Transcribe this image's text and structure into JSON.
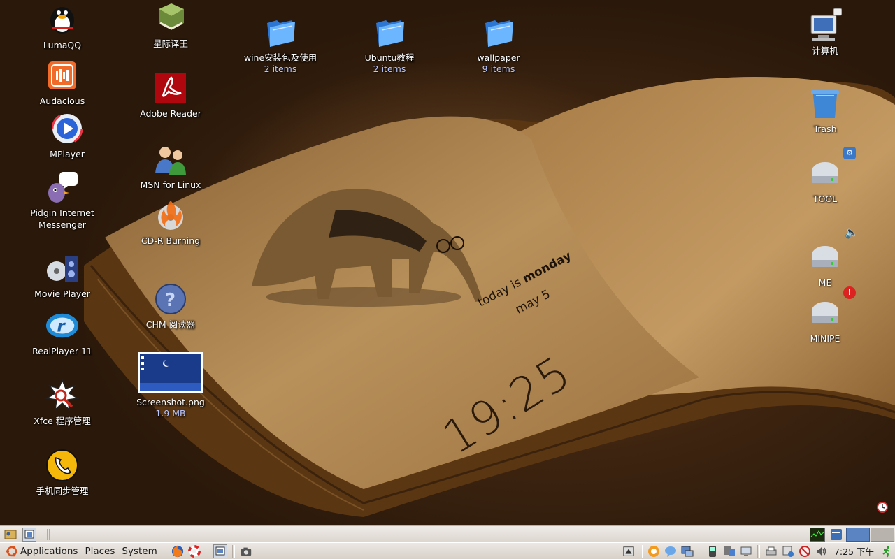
{
  "wallpaper": {
    "today_prefix": "today is ",
    "today_day": "monday",
    "date": "may 5",
    "clock": "19:25"
  },
  "desktop": {
    "col1": [
      {
        "label": "LumaQQ",
        "icon": "penguin-icon"
      },
      {
        "label": "Audacious",
        "icon": "audacious-icon"
      },
      {
        "label": "MPlayer",
        "icon": "play-icon"
      },
      {
        "label": "Pidgin Internet Messenger",
        "icon": "pidgin-icon"
      },
      {
        "label": "Movie Player",
        "icon": "movie-icon"
      },
      {
        "label": "RealPlayer 11",
        "icon": "realplayer-icon"
      },
      {
        "label": "Xfce 程序管理",
        "icon": "xfce-icon"
      },
      {
        "label": "手机同步管理",
        "icon": "phone-icon"
      }
    ],
    "col2": [
      {
        "label": "星际译王",
        "icon": "dictionary-book-icon"
      },
      {
        "label": "Adobe Reader",
        "icon": "pdf-icon"
      },
      {
        "label": "MSN for Linux",
        "icon": "msn-people-icon"
      },
      {
        "label": "CD-R Burning",
        "icon": "burn-icon"
      },
      {
        "label": "CHM 阅读器",
        "icon": "help-icon"
      },
      {
        "label": "Screenshot.png",
        "sub": "1.9 MB",
        "icon": "image-thumbnail-icon"
      }
    ],
    "folders": [
      {
        "label": "wine安装包及使用",
        "sub": "2 items"
      },
      {
        "label": "Ubuntu教程",
        "sub": "2 items"
      },
      {
        "label": "wallpaper",
        "sub": "9 items"
      }
    ],
    "right": [
      {
        "label": "计算机",
        "icon": "computer-icon"
      },
      {
        "label": "Trash",
        "icon": "trash-icon"
      },
      {
        "label": "TOOL",
        "icon": "drive-icon"
      },
      {
        "label": "ME",
        "icon": "drive-icon"
      },
      {
        "label": "MINIPE",
        "icon": "drive-icon"
      }
    ]
  },
  "panel": {
    "menu_applications": "Applications",
    "menu_places": "Places",
    "menu_system": "System",
    "clock": "7:25 下午"
  },
  "colors": {
    "panel_bg": "#e6e1db",
    "folder_blue": "#3d8fe6",
    "workspace_active": "#5a84c2"
  }
}
